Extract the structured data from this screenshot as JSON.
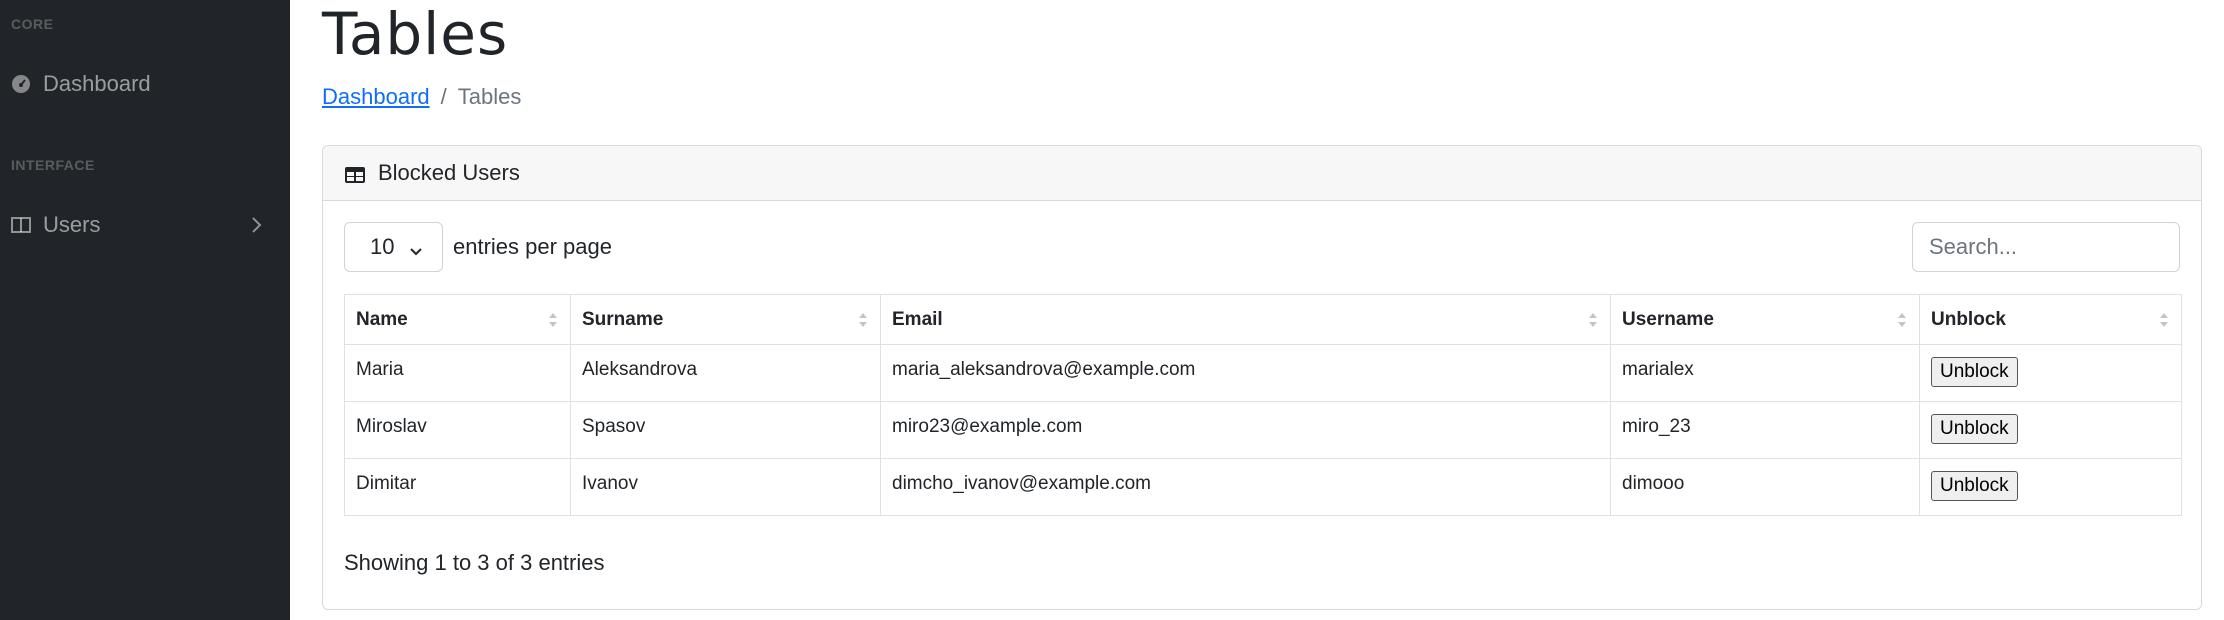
{
  "sidebar": {
    "core_heading": "CORE",
    "dashboard_label": "Dashboard",
    "interface_heading": "INTERFACE",
    "users_label": "Users"
  },
  "page": {
    "title": "Tables",
    "breadcrumb": {
      "home": "Dashboard",
      "separator": "/",
      "current": "Tables"
    }
  },
  "card": {
    "title": "Blocked Users",
    "entries_value": "10",
    "entries_label": "entries per page",
    "search_placeholder": "Search...",
    "columns": [
      "Name",
      "Surname",
      "Email",
      "Username",
      "Unblock"
    ],
    "rows": [
      {
        "name": "Maria",
        "surname": "Aleksandrova",
        "email": "maria_aleksandrova@example.com",
        "username": "marialex",
        "action": "Unblock"
      },
      {
        "name": "Miroslav",
        "surname": "Spasov",
        "email": "miro23@example.com",
        "username": "miro_23",
        "action": "Unblock"
      },
      {
        "name": "Dimitar",
        "surname": "Ivanov",
        "email": "dimcho_ivanov@example.com",
        "username": "dimooo",
        "action": "Unblock"
      }
    ],
    "info": "Showing 1 to 3 of 3 entries"
  },
  "colors": {
    "sidebar_bg": "#212529",
    "link": "#0d6efd",
    "card_header_bg": "#f7f7f7"
  },
  "icons": [
    "dashboard-icon",
    "columns-icon",
    "chevron-right-icon",
    "table-icon",
    "chevron-down-icon",
    "sort-icon"
  ]
}
